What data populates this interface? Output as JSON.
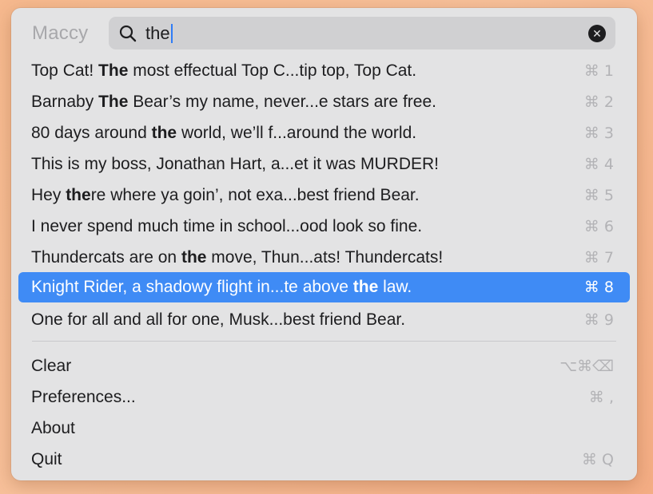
{
  "app": {
    "name": "Maccy"
  },
  "search": {
    "query": "the"
  },
  "history": [
    {
      "before": "Top Cat! ",
      "match": "The",
      "after": " most effectual Top C...tip top, Top Cat.",
      "shortcut": "⌘ 1",
      "selected": false
    },
    {
      "before": "Barnaby ",
      "match": "The",
      "after": " Bear’s my name, never...e stars are free.",
      "shortcut": "⌘ 2",
      "selected": false
    },
    {
      "before": "80 days around ",
      "match": "the",
      "after": " world, we’ll f...around the world.",
      "shortcut": "⌘ 3",
      "selected": false
    },
    {
      "before": "This is my boss, Jonathan Hart, a...et it was MURDER!",
      "match": "",
      "after": "",
      "shortcut": "⌘ 4",
      "selected": false
    },
    {
      "before": "Hey ",
      "match": "the",
      "after": "re where ya goin’, not exa...best friend Bear.",
      "shortcut": "⌘ 5",
      "selected": false
    },
    {
      "before": "I never spend much time in school...ood look so fine.",
      "match": "",
      "after": "",
      "shortcut": "⌘ 6",
      "selected": false
    },
    {
      "before": "Thundercats are on ",
      "match": "the",
      "after": " move, Thun...ats! Thundercats!",
      "shortcut": "⌘ 7",
      "selected": false
    },
    {
      "before": "Knight Rider, a shadowy flight in...te above ",
      "match": "the",
      "after": " law.",
      "shortcut": "⌘ 8",
      "selected": true
    },
    {
      "before": "One for all and all for one, Musk...best friend Bear.",
      "match": "",
      "after": "",
      "shortcut": "⌘ 9",
      "selected": false
    }
  ],
  "actions": {
    "clear": {
      "label": "Clear",
      "shortcut": "⌥⌘⌫"
    },
    "preferences": {
      "label": "Preferences...",
      "shortcut": "⌘ ,"
    },
    "about": {
      "label": "About",
      "shortcut": ""
    },
    "quit": {
      "label": "Quit",
      "shortcut": "⌘ Q"
    }
  },
  "colors": {
    "selection": "#3f8bf5",
    "menu_background": "#e3e3e4",
    "caret": "#2f7cf6"
  }
}
